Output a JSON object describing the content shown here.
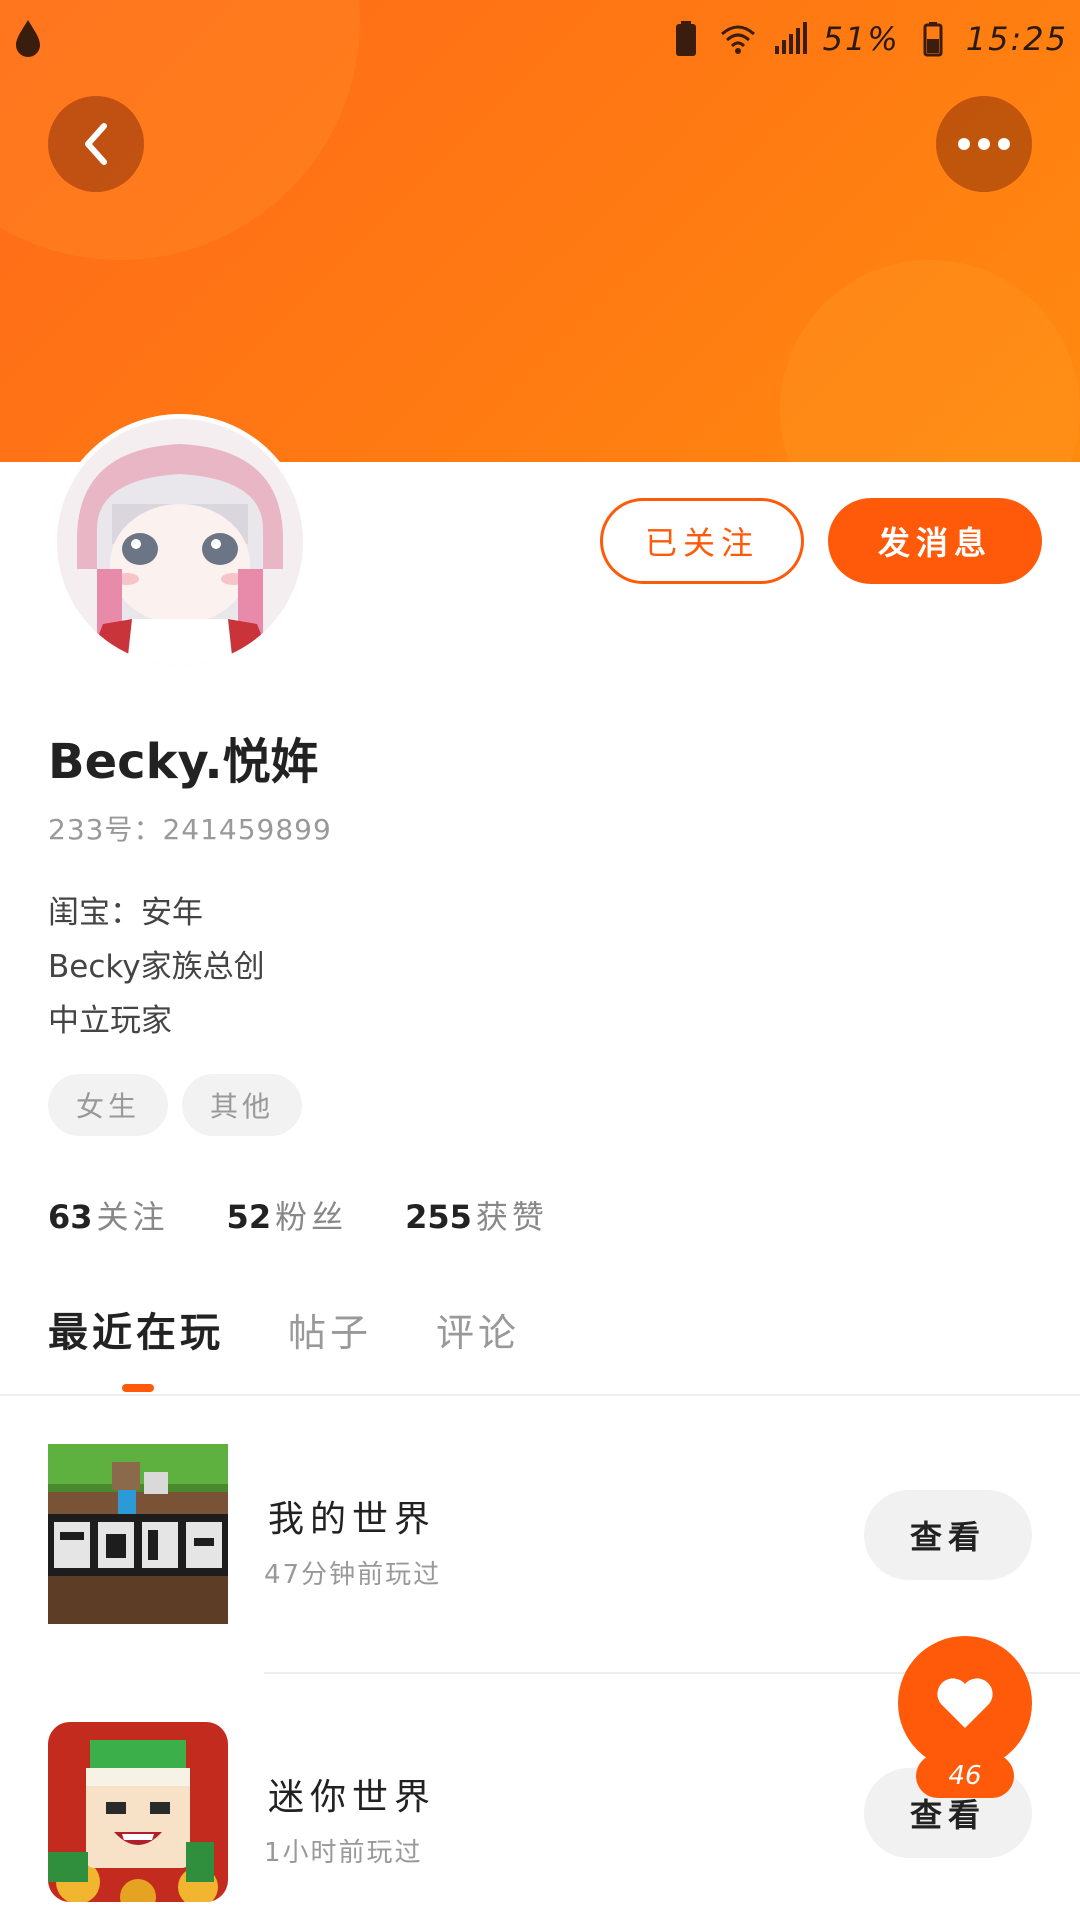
{
  "status_bar": {
    "battery_percent": "51%",
    "time": "15:25"
  },
  "profile": {
    "username": "Becky.悦姩",
    "id_text": "233号：241459899",
    "bio_lines": [
      "闺宝：安年",
      "Becky家族总创",
      "中立玩家"
    ],
    "tags": [
      "女生",
      "其他"
    ]
  },
  "actions": {
    "followed_label": "已关注",
    "message_label": "发消息"
  },
  "stats": {
    "following": {
      "count": "63",
      "label": "关注"
    },
    "fans": {
      "count": "52",
      "label": "粉丝"
    },
    "likes": {
      "count": "255",
      "label": "获赞"
    }
  },
  "tabs": [
    {
      "label": "最近在玩",
      "active": true
    },
    {
      "label": "帖子",
      "active": false
    },
    {
      "label": "评论",
      "active": false
    }
  ],
  "games": [
    {
      "title": "我的世界",
      "subtitle": "47分钟前玩过",
      "button_label": "查看"
    },
    {
      "title": "迷你世界",
      "subtitle": "1小时前玩过",
      "button_label": "查看"
    }
  ],
  "fab": {
    "like_count": "46"
  },
  "colors": {
    "accent": "#ff5a0a",
    "header_gradient_start": "#ff6a1a",
    "header_gradient_end": "#ff8a10"
  },
  "icons": {
    "back": "chevron-left-icon",
    "more": "more-dots-icon",
    "like": "heart-icon"
  }
}
